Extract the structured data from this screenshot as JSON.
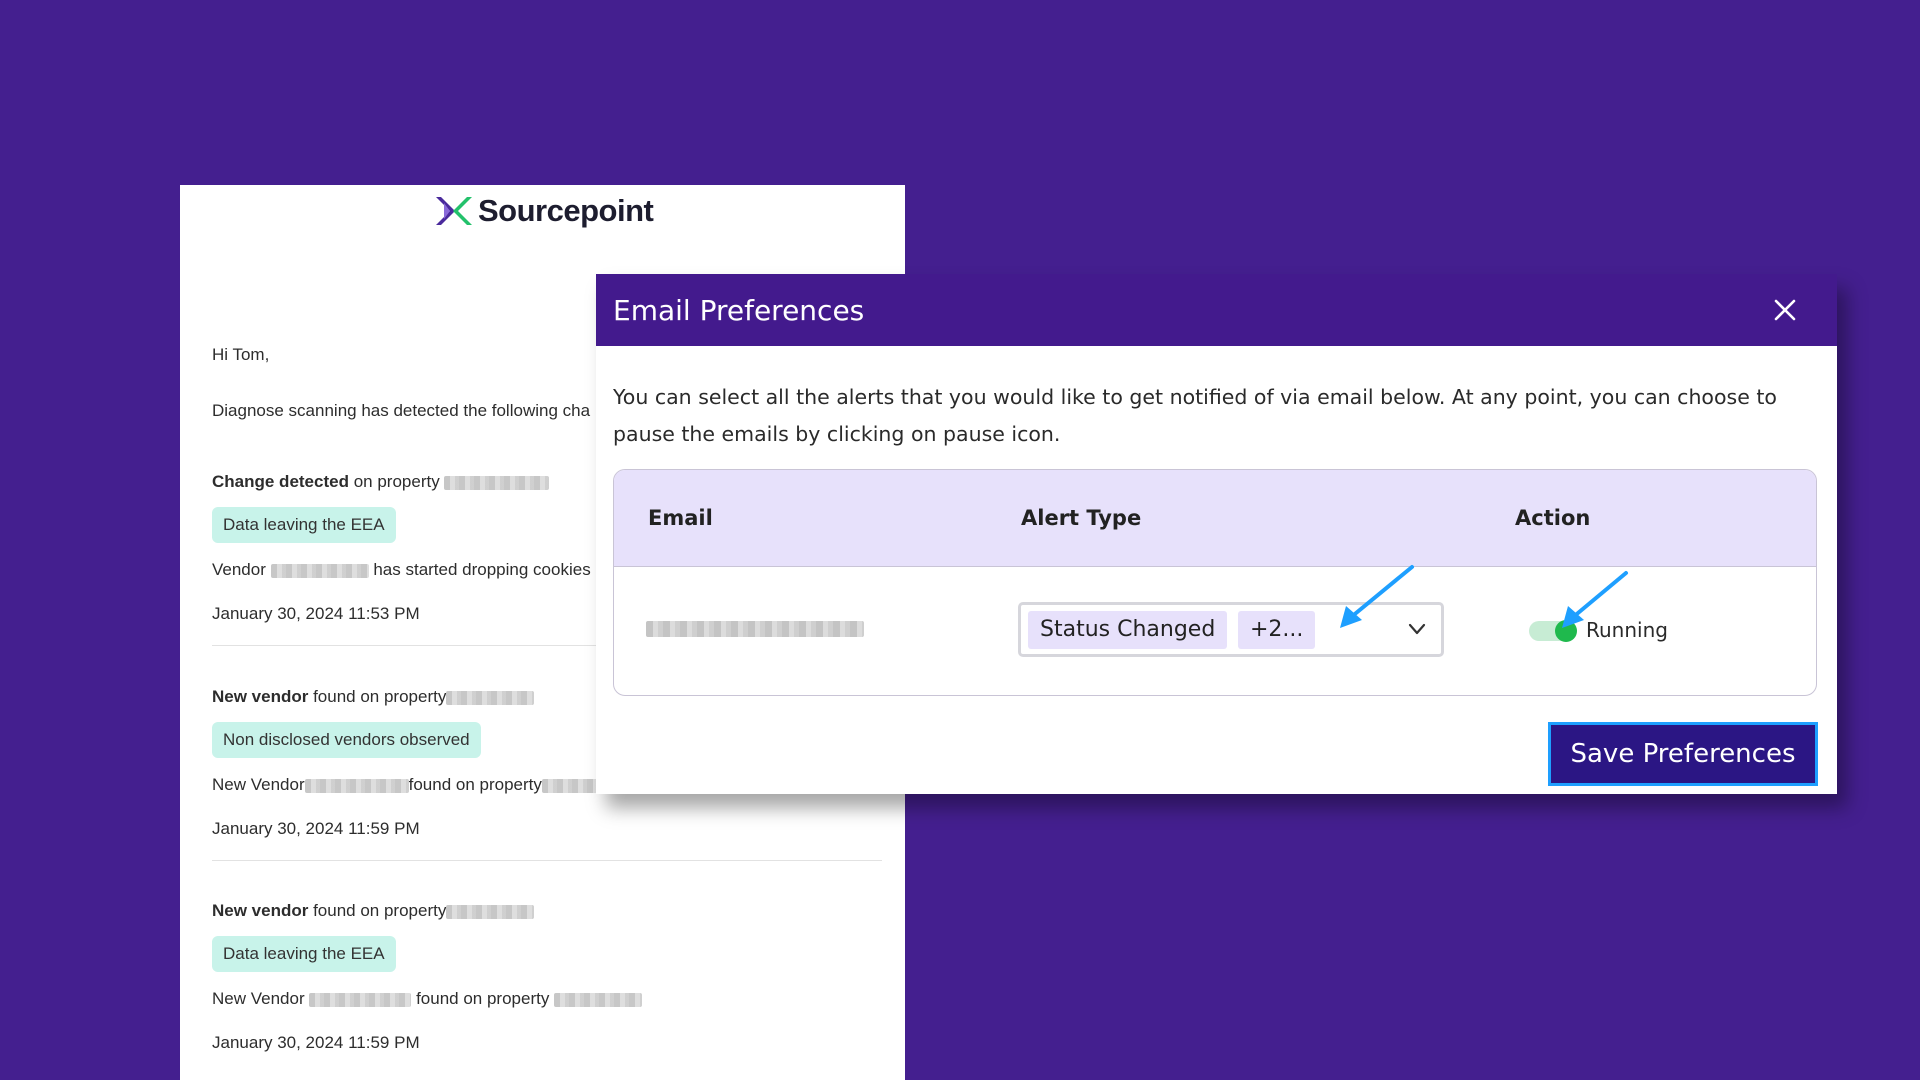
{
  "email": {
    "brand": "Sourcepoint",
    "greeting": "Hi Tom,",
    "intro": "Diagnose scanning has detected the following cha",
    "alerts": [
      {
        "title_bold": "Change detected",
        "title_rest": " on property ",
        "chip": "Data leaving the EEA",
        "detail_prefix": "Vendor ",
        "detail_suffix": " has started dropping cookies",
        "timestamp": "January 30, 2024 11:53 PM"
      },
      {
        "title_bold": "New vendor",
        "title_rest": " found on property",
        "chip": "Non disclosed vendors observed",
        "detail_prefix": "New Vendor",
        "detail_suffix": "found on property",
        "timestamp": "January 30, 2024 11:59 PM"
      },
      {
        "title_bold": "New vendor",
        "title_rest": " found on property",
        "chip": "Data leaving the EEA",
        "detail_prefix": "New Vendor ",
        "detail_suffix": " found on property ",
        "timestamp": "January 30, 2024 11:59 PM"
      }
    ]
  },
  "modal": {
    "title": "Email Preferences",
    "description": "You can select all the alerts that you would like to get notified of via email below. At any point, you can choose to pause the emails by clicking on pause icon.",
    "table": {
      "headers": {
        "email": "Email",
        "alert_type": "Alert Type",
        "action": "Action"
      },
      "row": {
        "tag_primary": "Status Changed",
        "tag_more": "+2...",
        "status": "Running"
      }
    },
    "save_label": "Save Preferences"
  },
  "colors": {
    "background": "#441f8f",
    "modal_header": "#431a8d",
    "table_header": "#e7e1fb",
    "chip": "#c8f3ea",
    "toggle_on": "#1fb94d",
    "save_button": "#2b1684",
    "annotation_arrow": "#1e9fff"
  },
  "icons": {
    "close": "close-icon",
    "dropdown": "chevron-down-icon",
    "logo": "sourcepoint-logo-icon",
    "annotation": "arrow-annotation-icon"
  }
}
